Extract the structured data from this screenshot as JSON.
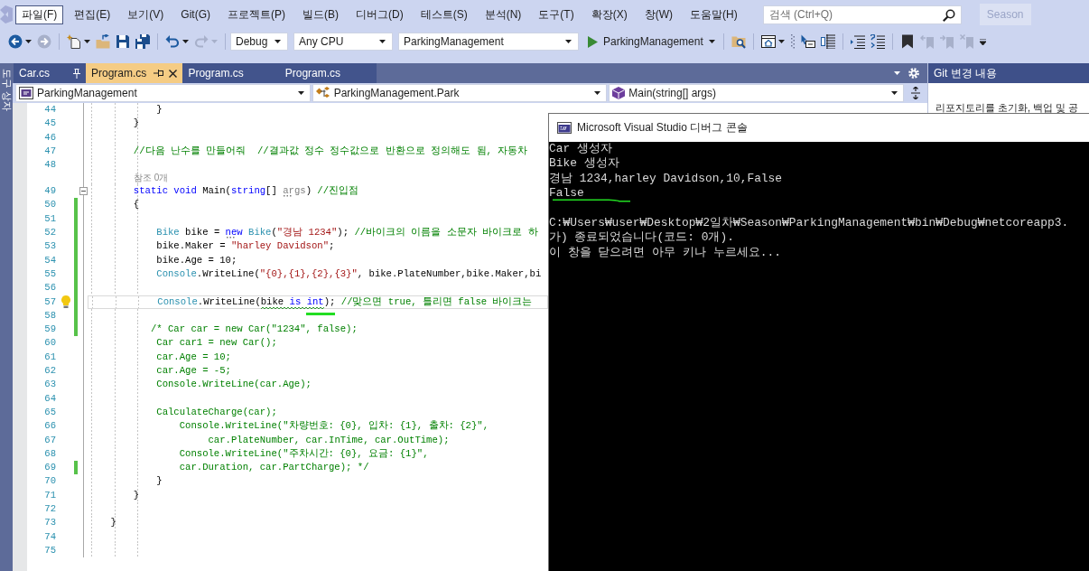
{
  "menu": {
    "items": [
      {
        "label": "파일(F)",
        "selected": true
      },
      {
        "label": "편집(E)",
        "selected": false
      },
      {
        "label": "보기(V)",
        "selected": false
      },
      {
        "label": "Git(G)",
        "selected": false
      },
      {
        "label": "프로젝트(P)",
        "selected": false
      },
      {
        "label": "빌드(B)",
        "selected": false
      },
      {
        "label": "디버그(D)",
        "selected": false
      },
      {
        "label": "테스트(S)",
        "selected": false
      },
      {
        "label": "분석(N)",
        "selected": false
      },
      {
        "label": "도구(T)",
        "selected": false
      },
      {
        "label": "확장(X)",
        "selected": false
      },
      {
        "label": "창(W)",
        "selected": false
      },
      {
        "label": "도움말(H)",
        "selected": false
      }
    ],
    "search": {
      "placeholder": "검색 (Ctrl+Q)"
    },
    "account": {
      "label": "Season"
    }
  },
  "toolbar": {
    "items": [
      {
        "kind": "back",
        "disabled": false
      },
      {
        "kind": "forward",
        "disabled": true
      },
      {
        "kind": "separator"
      },
      {
        "kind": "newitem",
        "disabled": false
      },
      {
        "kind": "open",
        "disabled": false
      },
      {
        "kind": "save",
        "disabled": false
      },
      {
        "kind": "saveall",
        "disabled": false
      },
      {
        "kind": "separator"
      },
      {
        "kind": "undo",
        "disabled": false
      },
      {
        "kind": "redo",
        "disabled": true
      },
      {
        "kind": "separator"
      },
      {
        "kind": "config",
        "value": "Debug"
      },
      {
        "kind": "platform",
        "value": "Any CPU"
      },
      {
        "kind": "project",
        "value": "ParkingManagement"
      },
      {
        "kind": "run",
        "label": "ParkingManagement"
      },
      {
        "kind": "separator"
      },
      {
        "kind": "foldersearch",
        "disabled": false
      },
      {
        "kind": "separator"
      },
      {
        "kind": "window",
        "disabled": false
      },
      {
        "kind": "grip"
      },
      {
        "kind": "pointer",
        "disabled": false
      },
      {
        "kind": "columns",
        "disabled": false
      },
      {
        "kind": "separator"
      },
      {
        "kind": "lines",
        "disabled": false
      },
      {
        "kind": "numbered",
        "disabled": false
      },
      {
        "kind": "separator"
      },
      {
        "kind": "bookmark",
        "disabled": false
      },
      {
        "kind": "bookmarkprev",
        "disabled": true
      },
      {
        "kind": "bookmarknext",
        "disabled": true
      },
      {
        "kind": "bookmarkclear",
        "disabled": true
      },
      {
        "kind": "overflow"
      }
    ]
  },
  "side_tab": {
    "label": "도구 상자"
  },
  "document_tabs": [
    {
      "label": "Car.cs",
      "selected": false,
      "pinned": true
    },
    {
      "label": "Program.cs",
      "selected": true,
      "pinned": false
    },
    {
      "label": "Program.cs",
      "selected": false,
      "pinned": false
    },
    {
      "label": "Program.cs",
      "selected": false,
      "pinned": false
    }
  ],
  "navigation": [
    {
      "kind": "project",
      "label": "ParkingManagement"
    },
    {
      "kind": "class",
      "label": "ParkingManagement.Park"
    },
    {
      "kind": "member",
      "label": "Main(string[] args)"
    }
  ],
  "editor": {
    "lines": [
      {
        "kind": "code",
        "number": "44",
        "changed": false,
        "current": false,
        "tokens": [
          {
            "kind": "plain",
            "text": "            }"
          }
        ]
      },
      {
        "kind": "code",
        "number": "45",
        "changed": false,
        "current": false,
        "tokens": [
          {
            "kind": "plain",
            "text": "        }"
          }
        ]
      },
      {
        "kind": "code",
        "number": "46",
        "changed": false,
        "current": false
      },
      {
        "kind": "code",
        "number": "47",
        "changed": false,
        "current": false,
        "tokens": [
          {
            "kind": "comment",
            "text": "        //다음 난수를 만들어줘  //결과값 정수 정수값으로 반환으로 정의해도 됨, 자동차"
          }
        ]
      },
      {
        "kind": "code",
        "number": "48",
        "changed": false,
        "current": false
      },
      {
        "kind": "lens",
        "text": "참조 0개"
      },
      {
        "kind": "code",
        "number": "49",
        "changed": false,
        "current": false,
        "expanded": true,
        "tokens": [
          {
            "kind": "keyword",
            "text": "        static void"
          },
          {
            "kind": "plain",
            "text": " Main("
          },
          {
            "kind": "keyword",
            "text": "string"
          },
          {
            "kind": "plain",
            "text": "[] "
          },
          {
            "kind": "param",
            "text": "args",
            "hinted": true
          },
          {
            "kind": "plain",
            "text": ") "
          },
          {
            "kind": "comment",
            "text": "//진입점"
          }
        ]
      },
      {
        "kind": "code",
        "number": "50",
        "changed": true,
        "current": false,
        "tokens": [
          {
            "kind": "plain",
            "text": "        {"
          }
        ]
      },
      {
        "kind": "code",
        "number": "51",
        "changed": true,
        "current": false
      },
      {
        "kind": "code",
        "number": "52",
        "changed": true,
        "current": false,
        "tokens": [
          {
            "kind": "type",
            "text": "            Bike"
          },
          {
            "kind": "plain",
            "text": " bike = "
          },
          {
            "kind": "keyword",
            "text": "new",
            "hinted": true
          },
          {
            "kind": "type",
            "text": " Bike"
          },
          {
            "kind": "plain",
            "text": "("
          },
          {
            "kind": "string",
            "text": "\"경남 1234\""
          },
          {
            "kind": "plain",
            "text": "); "
          },
          {
            "kind": "comment",
            "text": "//바이크의 이름을 소문자 바이크로 하"
          }
        ]
      },
      {
        "kind": "code",
        "number": "53",
        "changed": true,
        "current": false,
        "tokens": [
          {
            "kind": "plain",
            "text": "            bike.Maker = "
          },
          {
            "kind": "string",
            "text": "\"harley Davidson\""
          },
          {
            "kind": "plain",
            "text": ";"
          }
        ]
      },
      {
        "kind": "code",
        "number": "54",
        "changed": true,
        "current": false,
        "tokens": [
          {
            "kind": "plain",
            "text": "            bike.Age = 10;"
          }
        ]
      },
      {
        "kind": "code",
        "number": "55",
        "changed": true,
        "current": false,
        "tokens": [
          {
            "kind": "type",
            "text": "            Console"
          },
          {
            "kind": "plain",
            "text": ".WriteLine("
          },
          {
            "kind": "string",
            "text": "\"{0},{1},{2},{3}\""
          },
          {
            "kind": "plain",
            "text": ", bike.PlateNumber,bike.Maker,bi"
          }
        ]
      },
      {
        "kind": "code",
        "number": "56",
        "changed": true,
        "current": false
      },
      {
        "kind": "code",
        "number": "57",
        "changed": true,
        "current": true,
        "tokens": [
          {
            "kind": "type",
            "text": "            Console"
          },
          {
            "kind": "plain",
            "text": ".WriteLine("
          },
          {
            "kind": "plain",
            "text": "bike ",
            "warning": true
          },
          {
            "kind": "keyword",
            "text": "is ",
            "warning": true
          },
          {
            "kind": "keyword",
            "text": "int",
            "warning": true,
            "marked": true
          },
          {
            "kind": "plain",
            "text": "); "
          },
          {
            "kind": "comment",
            "text": "//맞으면 true, 틀리면 false 바이크는"
          }
        ]
      },
      {
        "kind": "code",
        "number": "58",
        "changed": true,
        "current": false
      },
      {
        "kind": "code",
        "number": "59",
        "changed": true,
        "current": false,
        "tokens": [
          {
            "kind": "comment",
            "text": "           /* Car car = new Car(\"1234\", false);"
          }
        ]
      },
      {
        "kind": "code",
        "number": "60",
        "changed": false,
        "current": false,
        "tokens": [
          {
            "kind": "comment",
            "text": "            Car car1 = new Car();"
          }
        ]
      },
      {
        "kind": "code",
        "number": "61",
        "changed": false,
        "current": false,
        "tokens": [
          {
            "kind": "comment",
            "text": "            car.Age = 10;"
          }
        ]
      },
      {
        "kind": "code",
        "number": "62",
        "changed": false,
        "current": false,
        "tokens": [
          {
            "kind": "comment",
            "text": "            car.Age = -5;"
          }
        ]
      },
      {
        "kind": "code",
        "number": "63",
        "changed": false,
        "current": false,
        "tokens": [
          {
            "kind": "comment",
            "text": "            Console.WriteLine(car.Age);"
          }
        ]
      },
      {
        "kind": "code",
        "number": "64",
        "changed": false,
        "current": false
      },
      {
        "kind": "code",
        "number": "65",
        "changed": false,
        "current": false,
        "tokens": [
          {
            "kind": "comment",
            "text": "            CalculateCharge(car);"
          }
        ]
      },
      {
        "kind": "code",
        "number": "66",
        "changed": false,
        "current": false,
        "tokens": [
          {
            "kind": "comment",
            "text": "                Console.WriteLine(\"차량번호: {0}, 입차: {1}, 출차: {2}\","
          }
        ]
      },
      {
        "kind": "code",
        "number": "67",
        "changed": false,
        "current": false,
        "tokens": [
          {
            "kind": "comment",
            "text": "                     car.PlateNumber, car.InTime, car.OutTime);"
          }
        ]
      },
      {
        "kind": "code",
        "number": "68",
        "changed": false,
        "current": false,
        "tokens": [
          {
            "kind": "comment",
            "text": "                Console.WriteLine(\"주차시간: {0}, 요금: {1}\","
          }
        ]
      },
      {
        "kind": "code",
        "number": "69",
        "changed": true,
        "current": false,
        "tokens": [
          {
            "kind": "comment",
            "text": "                car.Duration, car.PartCharge); */"
          }
        ]
      },
      {
        "kind": "code",
        "number": "70",
        "changed": false,
        "current": false,
        "tokens": [
          {
            "kind": "plain",
            "text": "            }"
          }
        ]
      },
      {
        "kind": "code",
        "number": "71",
        "changed": false,
        "current": false,
        "tokens": [
          {
            "kind": "plain",
            "text": "        }"
          }
        ]
      },
      {
        "kind": "code",
        "number": "72",
        "changed": false,
        "current": false
      },
      {
        "kind": "code",
        "number": "73",
        "changed": false,
        "current": false,
        "tokens": [
          {
            "kind": "plain",
            "text": "    }"
          }
        ]
      },
      {
        "kind": "code",
        "number": "74",
        "changed": false,
        "current": false
      },
      {
        "kind": "code",
        "number": "75",
        "changed": false,
        "current": false
      }
    ]
  },
  "git_panel": {
    "title": "Git 변경 내용",
    "message": "리포지토리를 초기화, 백업 및 공"
  },
  "console": {
    "title": "Microsoft Visual Studio 디버그 콘솔",
    "output": [
      {
        "text": "Car 생성자",
        "underlined": false
      },
      {
        "text": "Bike 생성자",
        "underlined": false
      },
      {
        "text": "경남 1234,harley Davidson,10,False",
        "underlined": false
      },
      {
        "text": "False",
        "underlined": true
      }
    ],
    "exit_message": [
      "C:₩Users₩user₩Desktop₩2일차₩Season₩ParkingManagement₩bin₩Debug₩netcoreapp3.",
      "가) 종료되었습니다(코드: 0개).",
      "이 창을 닫으려면 아무 키나 누르세요..."
    ]
  }
}
